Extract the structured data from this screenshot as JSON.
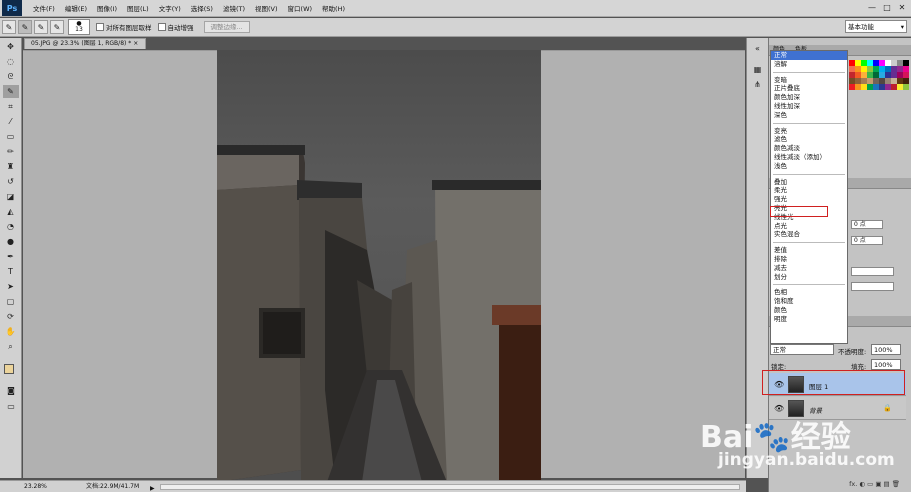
{
  "app": {
    "logo": "Ps"
  },
  "menubar": {
    "items": [
      "文件(F)",
      "编辑(E)",
      "图像(I)",
      "图层(L)",
      "文字(Y)",
      "选择(S)",
      "滤镜(T)",
      "视图(V)",
      "窗口(W)",
      "帮助(H)"
    ],
    "window_buttons": [
      "—",
      "□",
      "✕"
    ]
  },
  "options": {
    "brush_size": "13",
    "sample_all_layers": "对所有图层取样",
    "auto_enhance": "自动增强",
    "refine_edge": "调整边缘...",
    "workspace": "基本功能"
  },
  "document": {
    "tab_title": "05.JPG @ 23.3% (图层 1, RGB/8) *",
    "close": "×"
  },
  "status": {
    "zoom": "23.28%",
    "doc_size": "文档:22.9M/41.7M"
  },
  "panels": {
    "top_tabs": [
      "颜色",
      "色板"
    ]
  },
  "blend_menu": {
    "groups": [
      [
        "正常",
        "溶解"
      ],
      [
        "变暗",
        "正片叠底",
        "颜色加深",
        "线性加深",
        "深色"
      ],
      [
        "变亮",
        "滤色",
        "颜色减淡",
        "线性减淡（添加）",
        "浅色"
      ],
      [
        "叠加",
        "柔光",
        "强光",
        "亮光",
        "线性光",
        "点光",
        "实色混合"
      ],
      [
        "差值",
        "排除",
        "减去",
        "划分"
      ],
      [
        "色相",
        "饱和度",
        "颜色",
        "明度"
      ]
    ],
    "selected": "正常",
    "highlighted": "强光"
  },
  "adjust_fields": [
    "0 点",
    "0 点"
  ],
  "layers": {
    "blend_mode": "正常",
    "opacity_label": "不透明度:",
    "opacity_value": "100%",
    "lock_label": "锁定:",
    "fill_label": "填充:",
    "fill_value": "100%",
    "items": [
      {
        "name": "图层 1",
        "selected": true
      },
      {
        "name": "背景",
        "locked": true
      }
    ],
    "footer": "fx. ◐ ▭ ▣ ▤ 🗑"
  },
  "watermark": {
    "logo": "Bai",
    "logo_tail": "经验",
    "url": "jingyan.baidu.com"
  },
  "colors": {
    "foreground": "#ecd49b",
    "background": "#ffffff",
    "selection_blue": "#3f71d1",
    "highlight_red": "#d02020"
  }
}
